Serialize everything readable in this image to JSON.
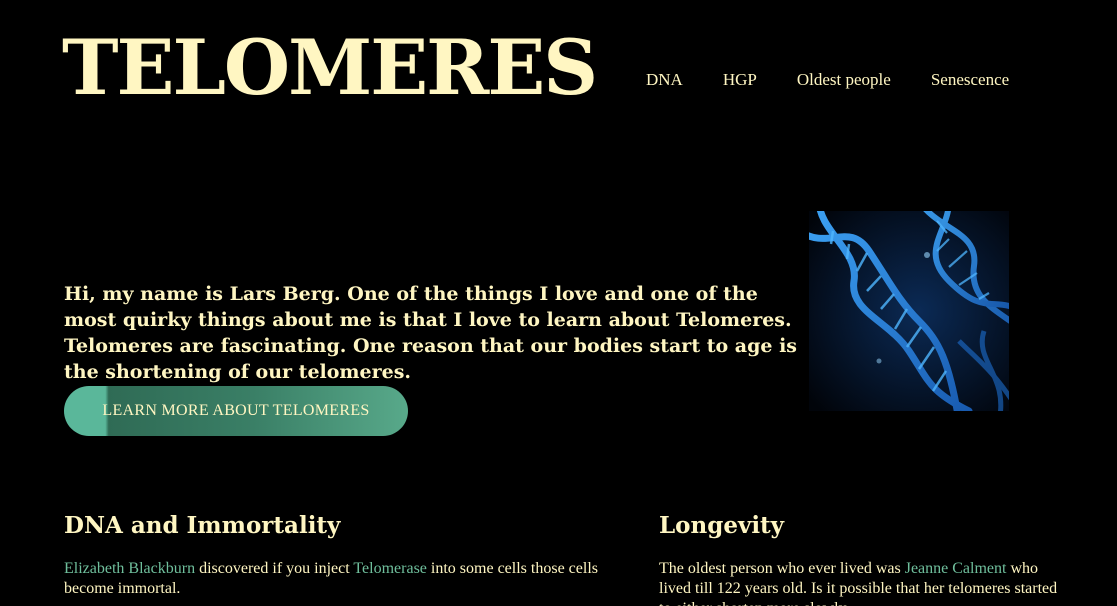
{
  "header": {
    "logo": "TELOMERES",
    "nav": [
      "DNA",
      "HGP",
      "Oldest people",
      "Senescence"
    ]
  },
  "hero": {
    "text": "Hi, my name is Lars Berg. One of the things I love and one of the most quirky things about me is that I love to learn about Telomeres. Telomeres are fascinating. One reason that our bodies start to age is the shortening of our telomeres.",
    "cta_label": "LEARN MORE ABOUT TELOMERES",
    "image_icon": "dna-helix-image"
  },
  "sections": [
    {
      "title": "DNA and Immortality",
      "link1": "Elizabeth Blackburn",
      "text1": " discovered if you inject ",
      "link2": "Telomerase",
      "text2": " into some cells those cells become immortal."
    },
    {
      "title": "Longevity",
      "text1": "The oldest person who ever lived was ",
      "link1": "Jeanne Calment",
      "text2": " who lived till 122 years old. Is it possible that her telomeres started to either shorten more slowly"
    }
  ],
  "colors": {
    "background": "#000000",
    "text": "#fff6c2",
    "link": "#6fbf9c",
    "button": "#5ab79a"
  }
}
